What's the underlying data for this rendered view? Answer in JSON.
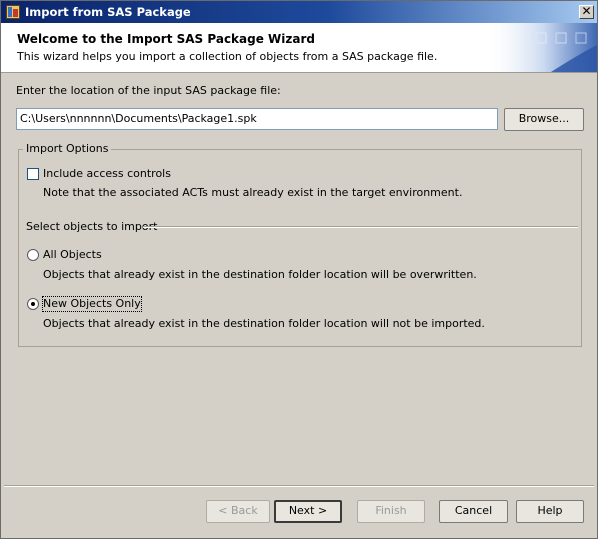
{
  "window": {
    "title": "Import from SAS Package",
    "close_glyph": "✕"
  },
  "banner": {
    "title": "Welcome to the Import SAS Package Wizard",
    "subtitle": "This wizard helps you import a collection of objects from a SAS package file."
  },
  "location": {
    "label": "Enter the location of the input SAS package file:",
    "value": "C:\\Users\\nnnnnn\\Documents\\Package1.spk",
    "browse_label": "Browse..."
  },
  "import_options": {
    "legend": "Import Options",
    "include_access_controls": {
      "label": "Include access controls",
      "checked": false,
      "note": "Note that the associated ACTs must already exist in the target environment."
    },
    "select_objects_label": "Select objects to import",
    "options": [
      {
        "label": "All Objects",
        "selected": false,
        "note": "Objects that already exist in the destination folder location will be overwritten."
      },
      {
        "label": "New Objects Only",
        "selected": true,
        "note": "Objects that already exist in the destination folder location will not be imported."
      }
    ]
  },
  "footer": {
    "back_label": "< Back",
    "next_label": "Next >",
    "finish_label": "Finish",
    "cancel_label": "Cancel",
    "help_label": "Help"
  },
  "icons": {
    "app": "sas-package-icon",
    "close": "close-icon"
  },
  "colors": {
    "titlebar_start": "#0a246a",
    "titlebar_end": "#a6caf0",
    "dialog_bg": "#d4d0c8"
  }
}
